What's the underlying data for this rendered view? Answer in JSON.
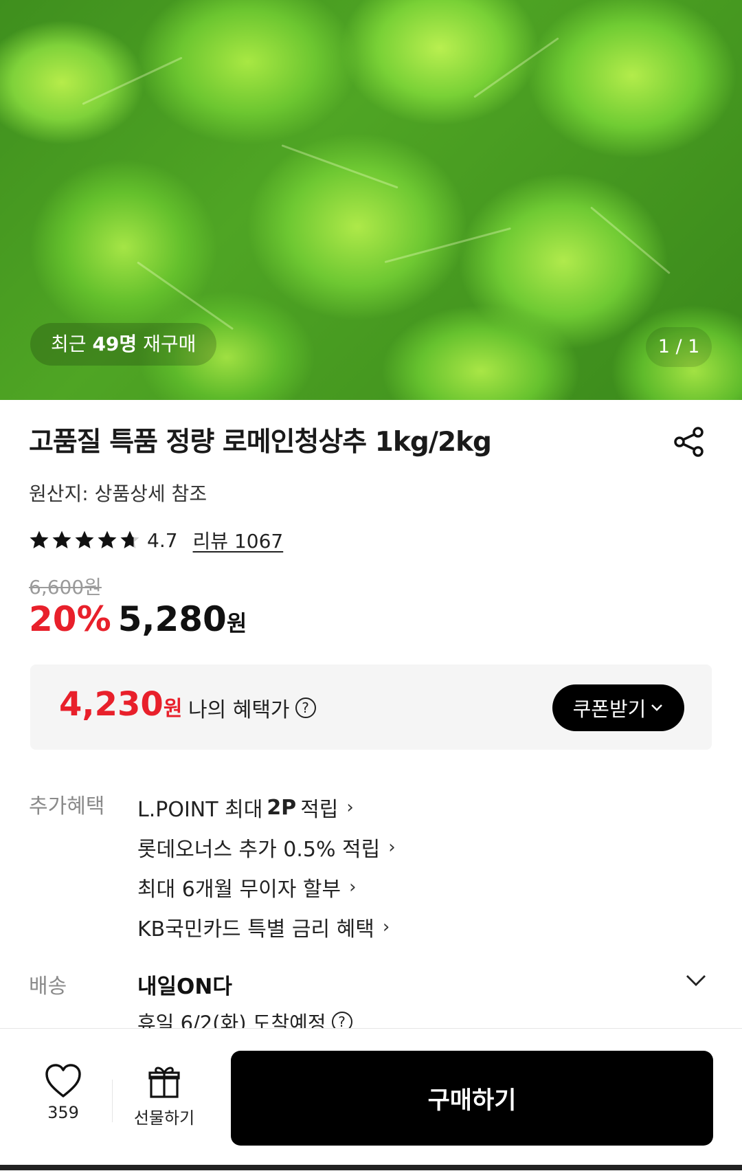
{
  "hero": {
    "repurchase_prefix": "최근",
    "repurchase_count": "49명",
    "repurchase_suffix": "재구매",
    "pager": "1 / 1"
  },
  "product": {
    "title": "고품질 특품 정량 로메인청상추 1kg/2kg",
    "origin": "원산지: 상품상세 참조",
    "rating": "4.7",
    "rating_stars": 4.7,
    "review_link": "리뷰 1067",
    "original_price": "6,600원",
    "discount": "20%",
    "price": "5,280",
    "price_unit": "원"
  },
  "benefit": {
    "price": "4,230",
    "price_unit": "원",
    "label": "나의 혜택가",
    "help_icon": "?",
    "coupon_button": "쿠폰받기",
    "coupon_chevron": "⌄"
  },
  "extra_benefits": {
    "section_label": "추가혜택",
    "items": [
      {
        "pre": "L.POINT 최대",
        "bold": "2P",
        "post": "적립"
      },
      {
        "pre": "롯데오너스 추가 0.5% 적립",
        "bold": "",
        "post": ""
      },
      {
        "pre": "최대 6개월 무이자 할부",
        "bold": "",
        "post": ""
      },
      {
        "pre": "KB국민카드 특별 금리 혜택",
        "bold": "",
        "post": ""
      }
    ],
    "chevron": "›"
  },
  "shipping": {
    "section_label": "배송",
    "title": "내일ON다",
    "subtitle": "휴일 6/2(화) 도착예정",
    "help_icon": "?"
  },
  "bottom_bar": {
    "wish_count": "359",
    "gift_label": "선물하기",
    "buy_button": "구매하기"
  },
  "colors": {
    "accent_red": "#e8202b",
    "button_black": "#000000",
    "benefit_bg": "#f5f5f5"
  },
  "icons": {
    "share": "share-icon",
    "star": "star-icon",
    "heart": "heart-icon",
    "gift": "gift-icon",
    "chevron_down": "chevron-down-icon",
    "chevron_right": "chevron-right-icon",
    "help": "help-circle-icon"
  }
}
